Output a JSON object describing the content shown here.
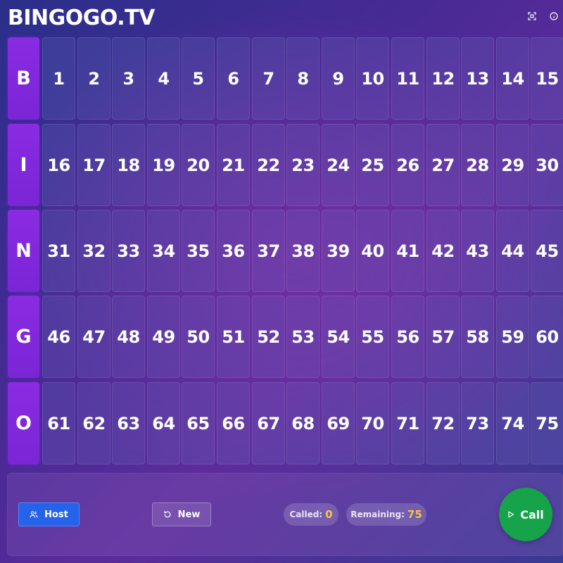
{
  "header": {
    "logo": "BINGOGO.TV",
    "icons": [
      "fullscreen-icon",
      "info-icon"
    ]
  },
  "board": {
    "rows": [
      {
        "letter": "B",
        "numbers": [
          "1",
          "2",
          "3",
          "4",
          "5",
          "6",
          "7",
          "8",
          "9",
          "10",
          "11",
          "12",
          "13",
          "14",
          "15"
        ]
      },
      {
        "letter": "I",
        "numbers": [
          "16",
          "17",
          "18",
          "19",
          "20",
          "21",
          "22",
          "23",
          "24",
          "25",
          "26",
          "27",
          "28",
          "29",
          "30"
        ]
      },
      {
        "letter": "N",
        "numbers": [
          "31",
          "32",
          "33",
          "34",
          "35",
          "36",
          "37",
          "38",
          "39",
          "40",
          "41",
          "42",
          "43",
          "44",
          "45"
        ]
      },
      {
        "letter": "G",
        "numbers": [
          "46",
          "47",
          "48",
          "49",
          "50",
          "51",
          "52",
          "53",
          "54",
          "55",
          "56",
          "57",
          "58",
          "59",
          "60"
        ]
      },
      {
        "letter": "O",
        "numbers": [
          "61",
          "62",
          "63",
          "64",
          "65",
          "66",
          "67",
          "68",
          "69",
          "70",
          "71",
          "72",
          "73",
          "74",
          "75"
        ]
      }
    ]
  },
  "controls": {
    "host_label": "Host",
    "host_icon": "users-icon",
    "new_label": "New",
    "new_icon": "refresh-icon",
    "called_label": "Called:",
    "called_value": "0",
    "remaining_label": "Remaining:",
    "remaining_value": "75",
    "call_label": "Call",
    "call_icon": "play-icon"
  },
  "colors": {
    "letter_bg": "#8a2be2",
    "host_button": "#2563eb",
    "call_button": "#16a34a",
    "counter_value": "#f5c542"
  }
}
